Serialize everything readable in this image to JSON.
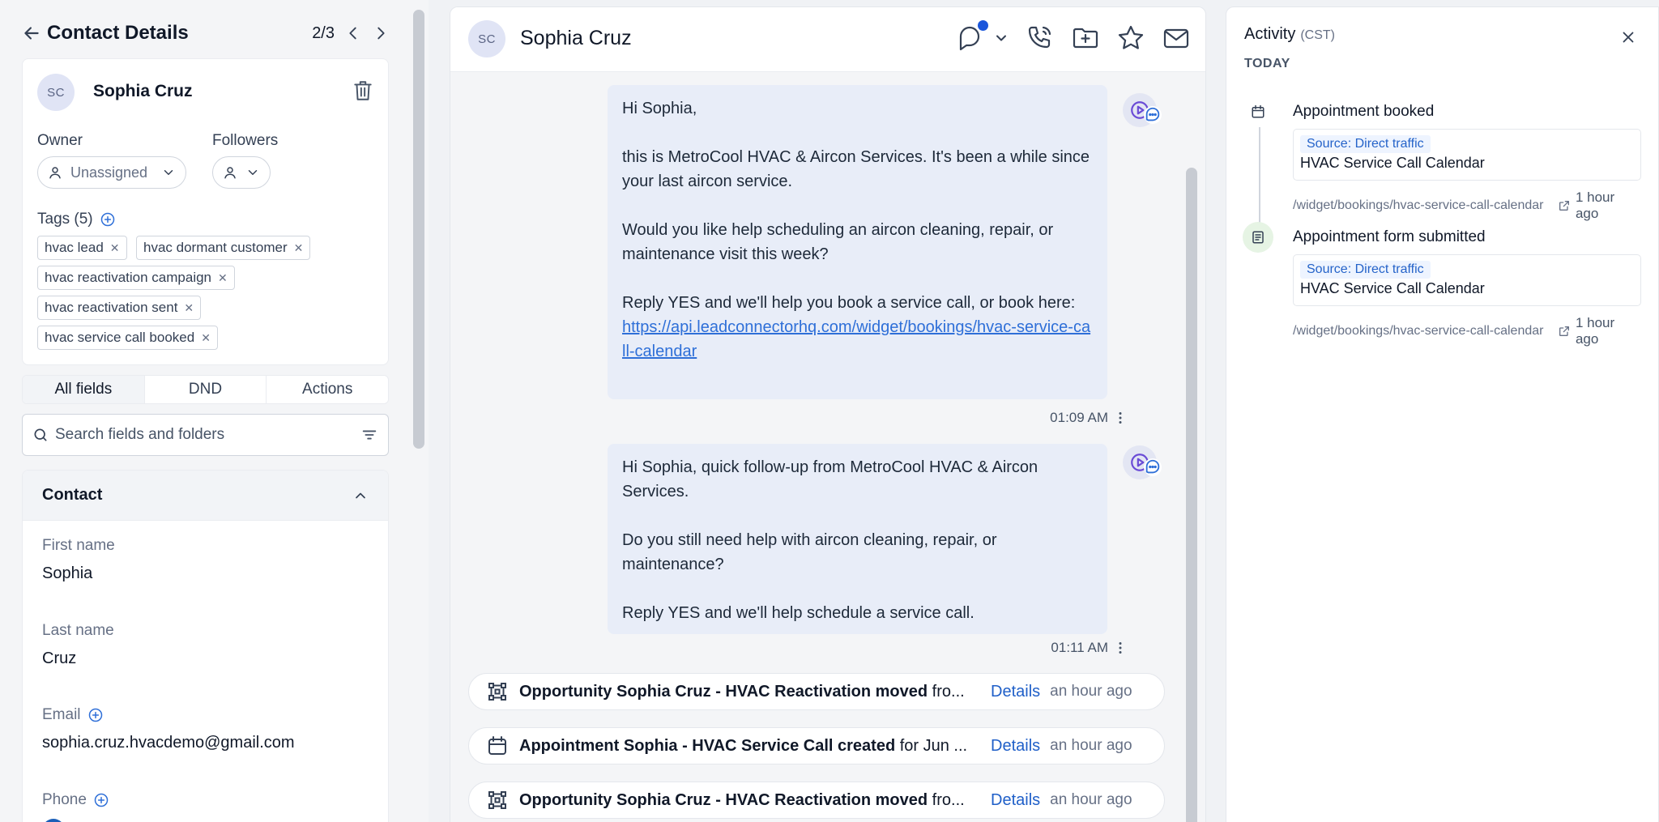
{
  "left": {
    "header": {
      "title": "Contact Details",
      "pager": "2/3"
    },
    "contact": {
      "initials": "SC",
      "name": "Sophia Cruz"
    },
    "owner": {
      "label": "Owner",
      "value": "Unassigned"
    },
    "followers": {
      "label": "Followers"
    },
    "tags": {
      "label": "Tags (5)",
      "items": [
        "hvac lead",
        "hvac dormant customer",
        "hvac reactivation campaign",
        "hvac reactivation sent",
        "hvac service call booked"
      ]
    },
    "tabs": [
      "All fields",
      "DND",
      "Actions"
    ],
    "search": {
      "placeholder": "Search fields and folders"
    },
    "section": {
      "title": "Contact"
    },
    "fields": {
      "first_name_label": "First name",
      "first_name": "Sophia",
      "last_name_label": "Last name",
      "last_name": "Cruz",
      "email_label": "Email",
      "email": "sophia.cruz.hvacdemo@gmail.com",
      "phone_label": "Phone"
    }
  },
  "center": {
    "header": {
      "initials": "SC",
      "name": "Sophia Cruz"
    },
    "messages": [
      {
        "text": "Hi Sophia,\n\nthis is MetroCool HVAC & Aircon Services. It's been a while since your last aircon service.\n\nWould you like help scheduling an aircon cleaning, repair, or maintenance visit this week?\n\nReply YES and we'll help you book a service call, or book here:",
        "link": "https://api.leadconnectorhq.com/widget/bookings/hvac-service-call-calendar",
        "time": "01:09 AM"
      },
      {
        "text": "Hi Sophia, quick follow-up from MetroCool HVAC & Aircon Services.\n\nDo you still need help with aircon cleaning, repair, or maintenance?\n\nReply YES and we'll help schedule a service call.",
        "time": "01:11 AM"
      }
    ],
    "events": [
      {
        "bold": "Opportunity Sophia Cruz - HVAC Reactivation moved",
        "rest": " fro...",
        "details": "Details",
        "ago": "an hour ago",
        "icon": "pipeline-icon"
      },
      {
        "bold": "Appointment Sophia - HVAC Service Call created",
        "rest": " for Jun ...",
        "details": "Details",
        "ago": "an hour ago",
        "icon": "calendar-icon"
      },
      {
        "bold": "Opportunity Sophia Cruz - HVAC Reactivation moved",
        "rest": " fro...",
        "details": "Details",
        "ago": "an hour ago",
        "icon": "pipeline-icon"
      }
    ]
  },
  "right": {
    "title": "Activity",
    "tz": "(CST)",
    "today": "TODAY",
    "items": [
      {
        "title": "Appointment booked",
        "source": "Source: Direct traffic",
        "calendar": "HVAC Service Call Calendar",
        "path": "/widget/bookings/hvac-service-call-calendar",
        "when": "1 hour ago"
      },
      {
        "title": "Appointment form submitted",
        "source": "Source: Direct traffic",
        "calendar": "HVAC Service Call Calendar",
        "path": "/widget/bookings/hvac-service-call-calendar",
        "when": "1 hour ago"
      }
    ]
  },
  "colors": {
    "accent": "#2e6fd8",
    "bubble": "#e8edf8",
    "dot": "#1a56db"
  }
}
